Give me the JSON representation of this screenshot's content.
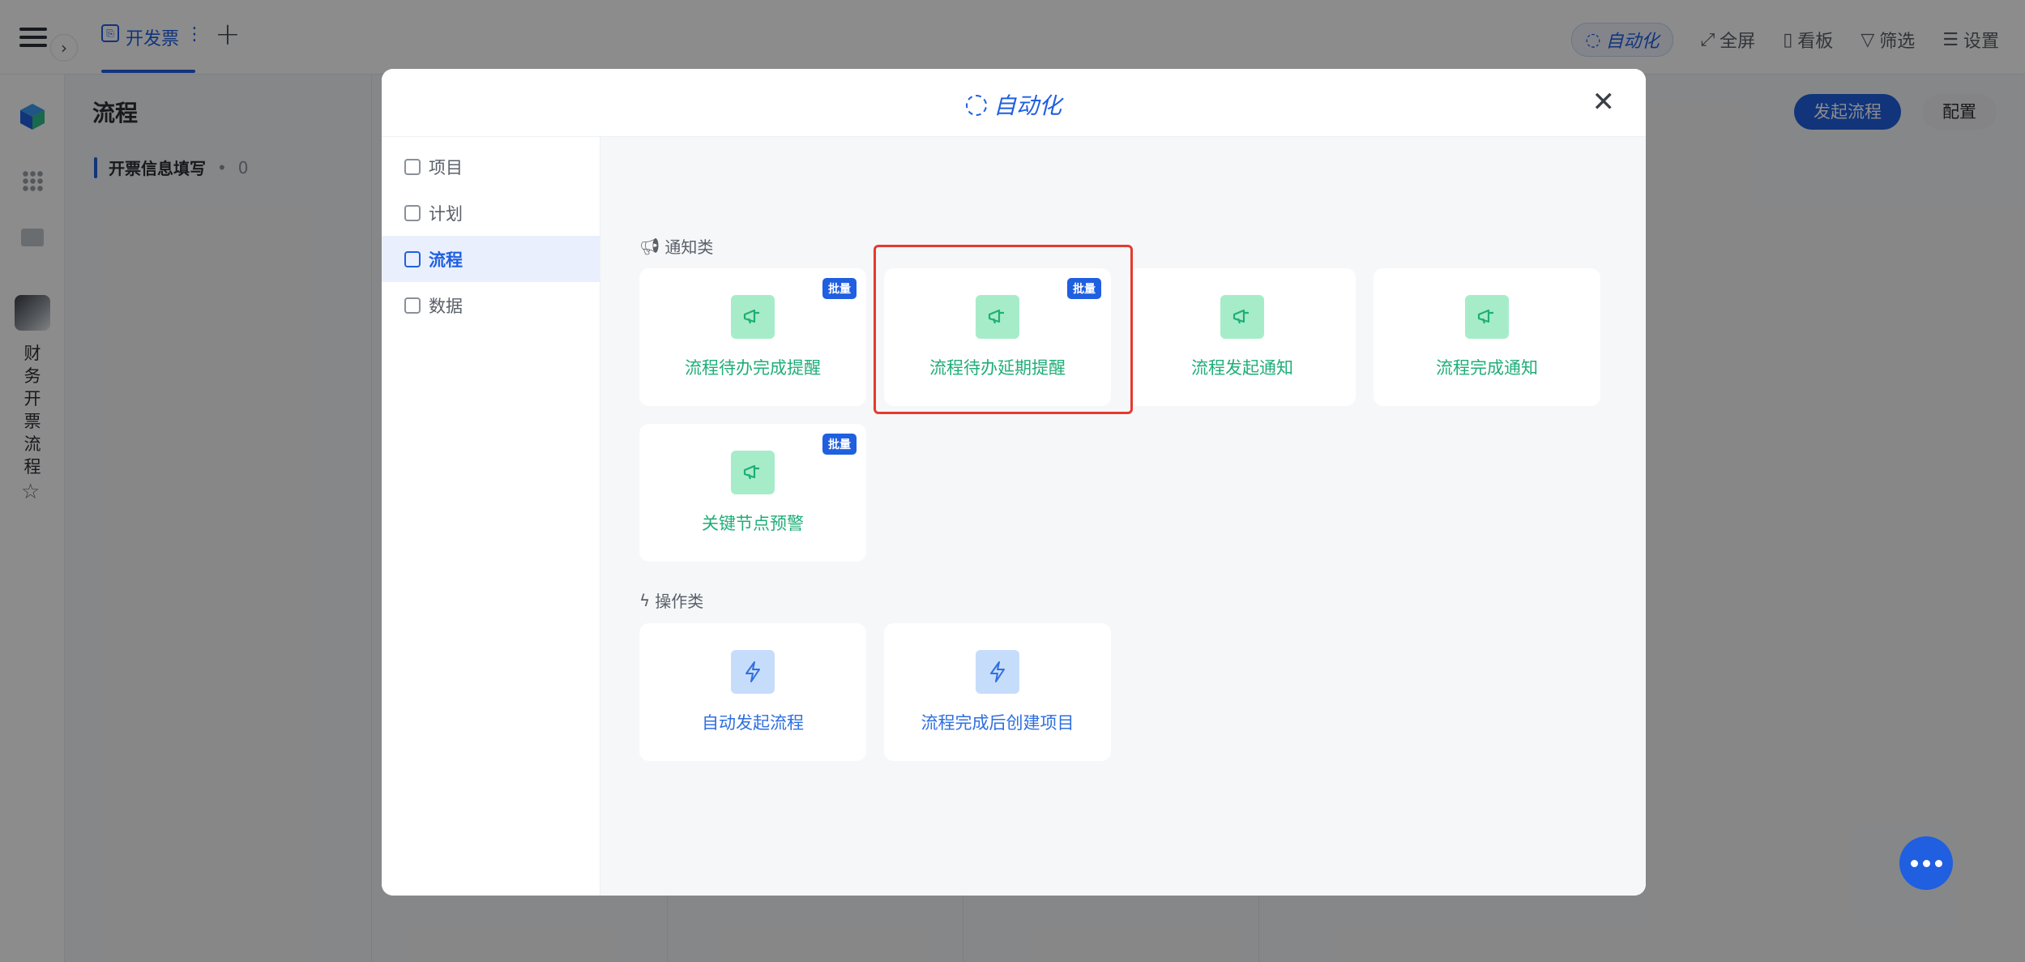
{
  "topbar": {
    "tab_label": "开发票",
    "toolbar": {
      "automation": "自动化",
      "fullscreen": "全屏",
      "board": "看板",
      "filter": "筛选",
      "settings": "设置"
    }
  },
  "sidebar": {
    "app_name": "财务开票流程"
  },
  "main": {
    "title": "流程",
    "node_name": "开票信息填写",
    "node_separator": "•",
    "node_count": "0",
    "start_button": "发起流程",
    "config_button": "配置"
  },
  "modal": {
    "title": "自动化",
    "menu": [
      {
        "label": "项目",
        "icon": "project-icon"
      },
      {
        "label": "计划",
        "icon": "plan-icon"
      },
      {
        "label": "流程",
        "icon": "process-icon",
        "active": true
      },
      {
        "label": "数据",
        "icon": "data-icon"
      }
    ],
    "notify_section": "通知类",
    "action_section": "操作类",
    "batch_badge": "批量",
    "notify_cards": [
      {
        "label": "流程待办完成提醒",
        "batch": true
      },
      {
        "label": "流程待办延期提醒",
        "batch": true,
        "highlighted": true
      },
      {
        "label": "流程发起通知",
        "batch": false
      },
      {
        "label": "流程完成通知",
        "batch": false
      },
      {
        "label": "关键节点预警",
        "batch": true
      }
    ],
    "action_cards": [
      {
        "label": "自动发起流程"
      },
      {
        "label": "流程完成后创建项目"
      }
    ]
  },
  "colors": {
    "accent": "#1f5fe0",
    "notify_green": "#1fae78",
    "notify_icon_bg": "#a7ecc9",
    "action_icon_bg": "#c6dcfb",
    "highlight_red": "#e53a2f"
  }
}
